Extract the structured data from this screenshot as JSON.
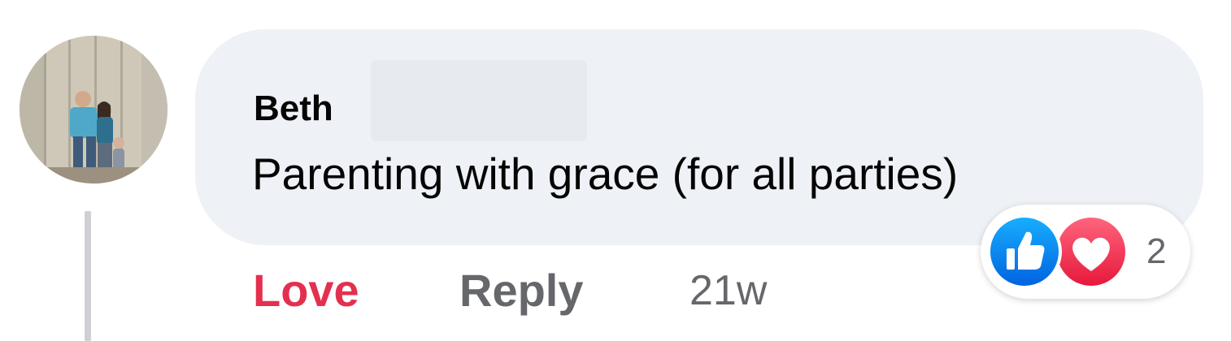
{
  "comment": {
    "author": "Beth",
    "text": "Parenting with grace (for all parties)"
  },
  "actions": {
    "love_label": "Love",
    "reply_label": "Reply",
    "timestamp": "21w"
  },
  "reactions": {
    "types": [
      "like-icon",
      "heart-icon"
    ],
    "count": "2"
  },
  "colors": {
    "bubble": "#eef1f5",
    "love": "#e4304f",
    "secondary_text": "#65676b",
    "like_blue": "#1877f2",
    "heart_red": "#f33e58"
  }
}
